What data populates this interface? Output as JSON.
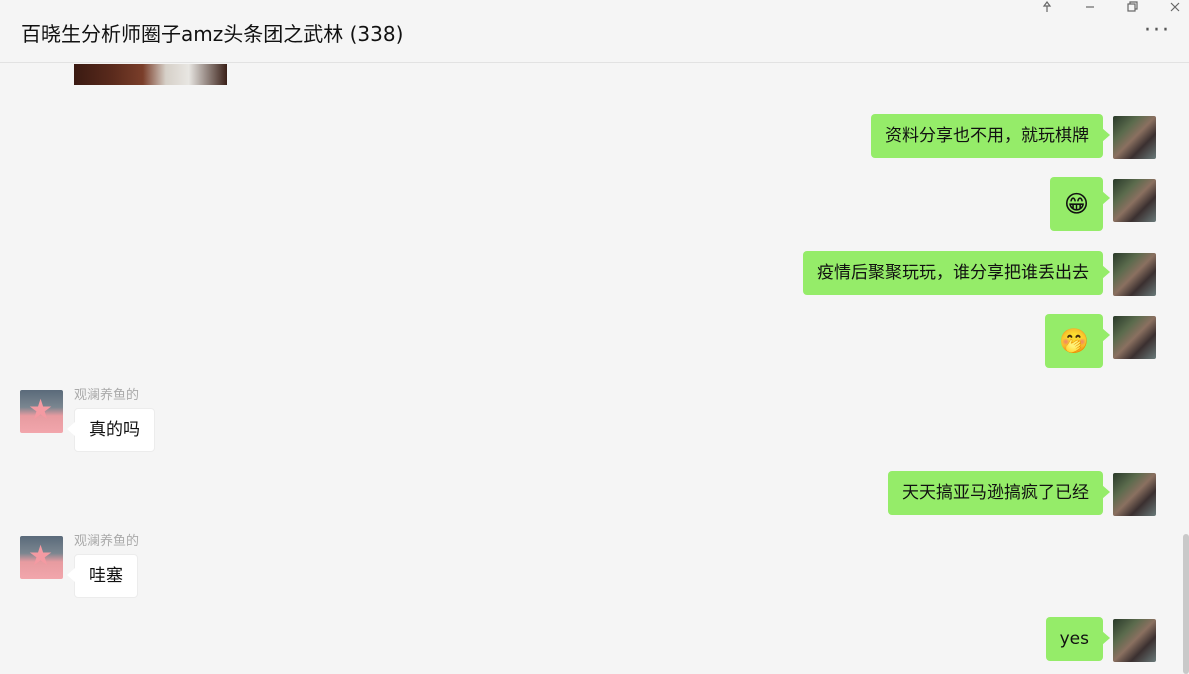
{
  "window": {
    "title": "百晓生分析师圈子amz头条团之武林 (338)",
    "controls": [
      "pin-icon",
      "minimize-icon",
      "restore-icon",
      "close-icon"
    ],
    "more_label": "···"
  },
  "messages": [
    {
      "side": "right",
      "text": "资料分享也不用，就玩棋牌"
    },
    {
      "side": "right",
      "emoji": "😁"
    },
    {
      "side": "right",
      "text": "疫情后聚聚玩玩，谁分享把谁丢出去"
    },
    {
      "side": "right",
      "emoji": "🤭"
    },
    {
      "side": "left",
      "sender": "观澜养鱼的",
      "text": "真的吗"
    },
    {
      "side": "right",
      "text": "天天搞亚马逊搞疯了已经"
    },
    {
      "side": "left",
      "sender": "观澜养鱼的",
      "text": "哇塞"
    },
    {
      "side": "right",
      "text": "yes"
    }
  ],
  "colors": {
    "self_bubble": "#95ec69",
    "other_bubble": "#ffffff",
    "background": "#f5f5f5"
  }
}
